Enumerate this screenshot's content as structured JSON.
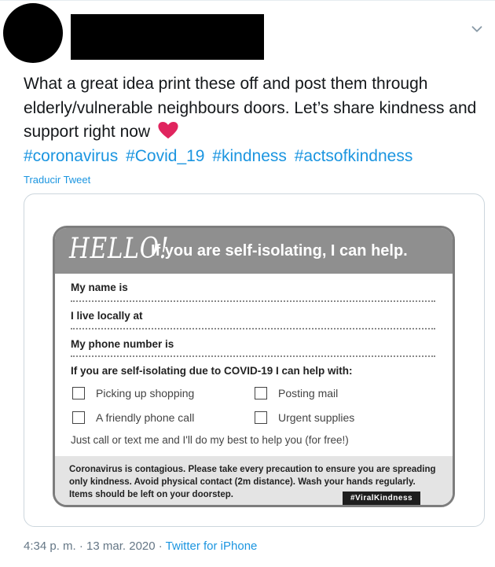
{
  "tweet": {
    "text": "What a great idea print these off and post them through elderly/vulnerable neighbours doors. Let’s share kindness and support right now",
    "hashtags": [
      "#coronavirus",
      "#Covid_19",
      "#kindness",
      "#actsofkindness"
    ],
    "translate_label": "Traducir Tweet",
    "timestamp": "4:34 p. m. · 13 mar. 2020",
    "separator": " · ",
    "source": "Twitter for iPhone"
  },
  "colors": {
    "link": "#1b95e0",
    "heart": "#e0245e",
    "flyer_header": "#8f8f8f"
  },
  "flyer": {
    "hello": "HELLO!",
    "header_text": "If you are self-isolating, I can help.",
    "fields": [
      "My name is",
      "I live locally at",
      "My phone number is"
    ],
    "help_line": "If you are self-isolating due to COVID-19 I can help with:",
    "options": [
      "Picking up shopping",
      "Posting mail",
      "A friendly phone call",
      "Urgent supplies"
    ],
    "just_call": "Just call or text me and I'll do my best to help you (for free!)",
    "footer_text": "Coronavirus is contagious. Please take every precaution to ensure you are spreading only kindness. Avoid physical contact (2m distance). Wash your hands regularly. Items should be left on your doorstep.",
    "hashtag_badge": "#ViralKindness"
  }
}
